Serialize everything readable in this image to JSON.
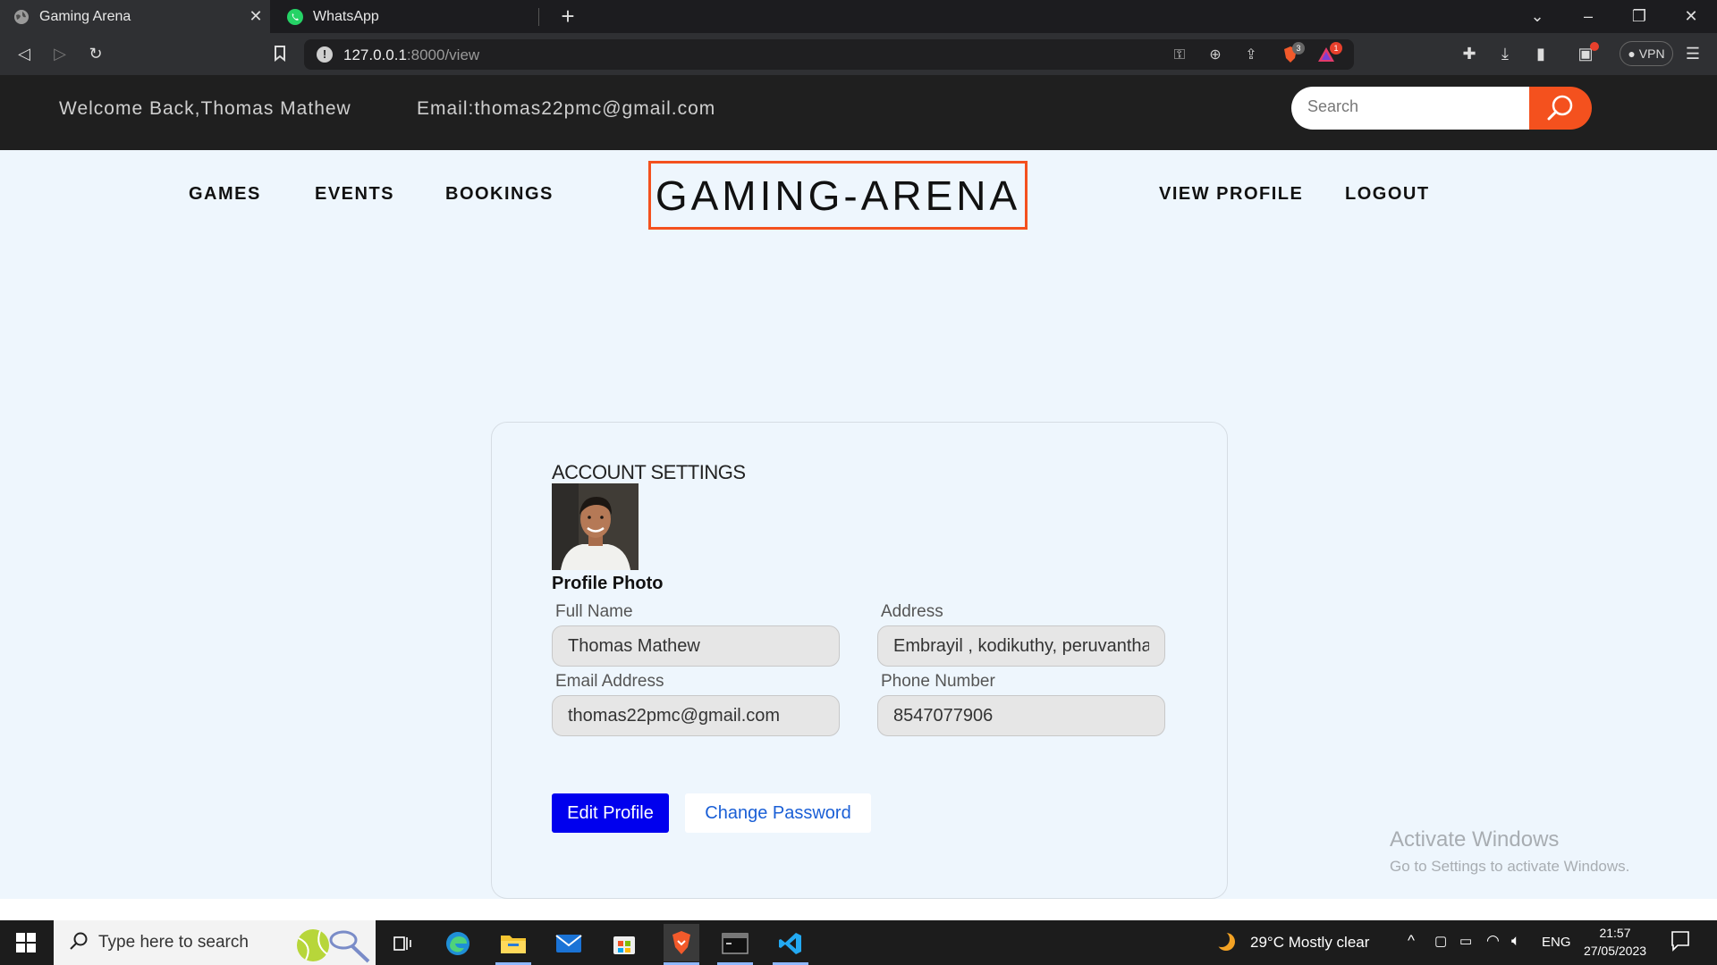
{
  "browser": {
    "tabs": [
      {
        "label": "Gaming Arena",
        "active": true,
        "icon": "globe-icon"
      },
      {
        "label": "WhatsApp",
        "active": false,
        "icon": "whatsapp-icon"
      }
    ],
    "url_host": "127.0.0.1",
    "url_path": ":8000/view",
    "shields_badge": "3",
    "rewards_badge": "1",
    "vpn_label": "VPN"
  },
  "header": {
    "welcome": "Welcome Back,Thomas Mathew",
    "email": "Email:thomas22pmc@gmail.com",
    "search_placeholder": "Search"
  },
  "nav": {
    "games": "GAMES",
    "events": "EVENTS",
    "bookings": "BOOKINGS",
    "logo": "GAMING-ARENA",
    "view_profile": "VIEW PROFILE",
    "logout": "LOGOUT"
  },
  "account": {
    "title": "ACCOUNT SETTINGS",
    "photo_label": "Profile Photo",
    "fields": {
      "full_name": {
        "label": "Full Name",
        "value": "Thomas Mathew"
      },
      "address": {
        "label": "Address",
        "value": "Embrayil , kodikuthy, peruvanthanam"
      },
      "email": {
        "label": "Email Address",
        "value": "thomas22pmc@gmail.com"
      },
      "phone": {
        "label": "Phone Number",
        "value": "8547077906"
      }
    },
    "edit_button": "Edit Profile",
    "change_password_button": "Change Password"
  },
  "watermark": {
    "line1": "Activate Windows",
    "line2": "Go to Settings to activate Windows."
  },
  "taskbar": {
    "search_placeholder": "Type here to search",
    "weather": "29°C  Mostly clear",
    "language": "ENG",
    "time": "21:57",
    "date": "27/05/2023"
  },
  "colors": {
    "accent": "#f4511e",
    "edit_button": "#0000ee",
    "page_bg": "#eef6fd",
    "header_bg": "#1f1f1f"
  }
}
